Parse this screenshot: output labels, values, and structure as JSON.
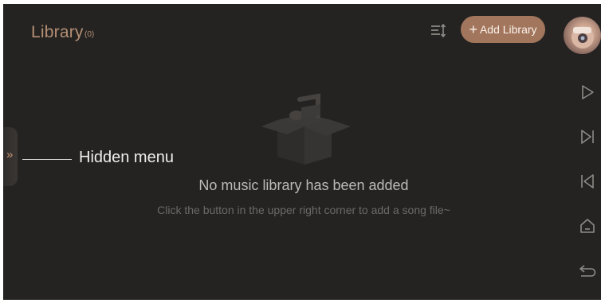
{
  "header": {
    "title": "Library",
    "count": "(0)",
    "add_button_label": "Add Library",
    "add_button_plus": "+"
  },
  "icons": {
    "sort": "sort-icon",
    "avatar": "avatar",
    "play": "play-icon",
    "skip_next": "skip-next-icon",
    "skip_previous": "skip-previous-icon",
    "home": "home-icon",
    "back": "back-icon",
    "empty_state": "music-box-icon",
    "hidden_menu": "chevron-double-right-icon"
  },
  "empty_state": {
    "title": "No music library has been added",
    "subtitle": "Click the button in the upper right corner to add a song file~"
  },
  "callout": {
    "label": "Hidden menu",
    "glyph": "»"
  },
  "colors": {
    "background": "#242322",
    "accent": "#a2765c",
    "title": "#b58f74",
    "icon_muted": "#8e8b87"
  }
}
